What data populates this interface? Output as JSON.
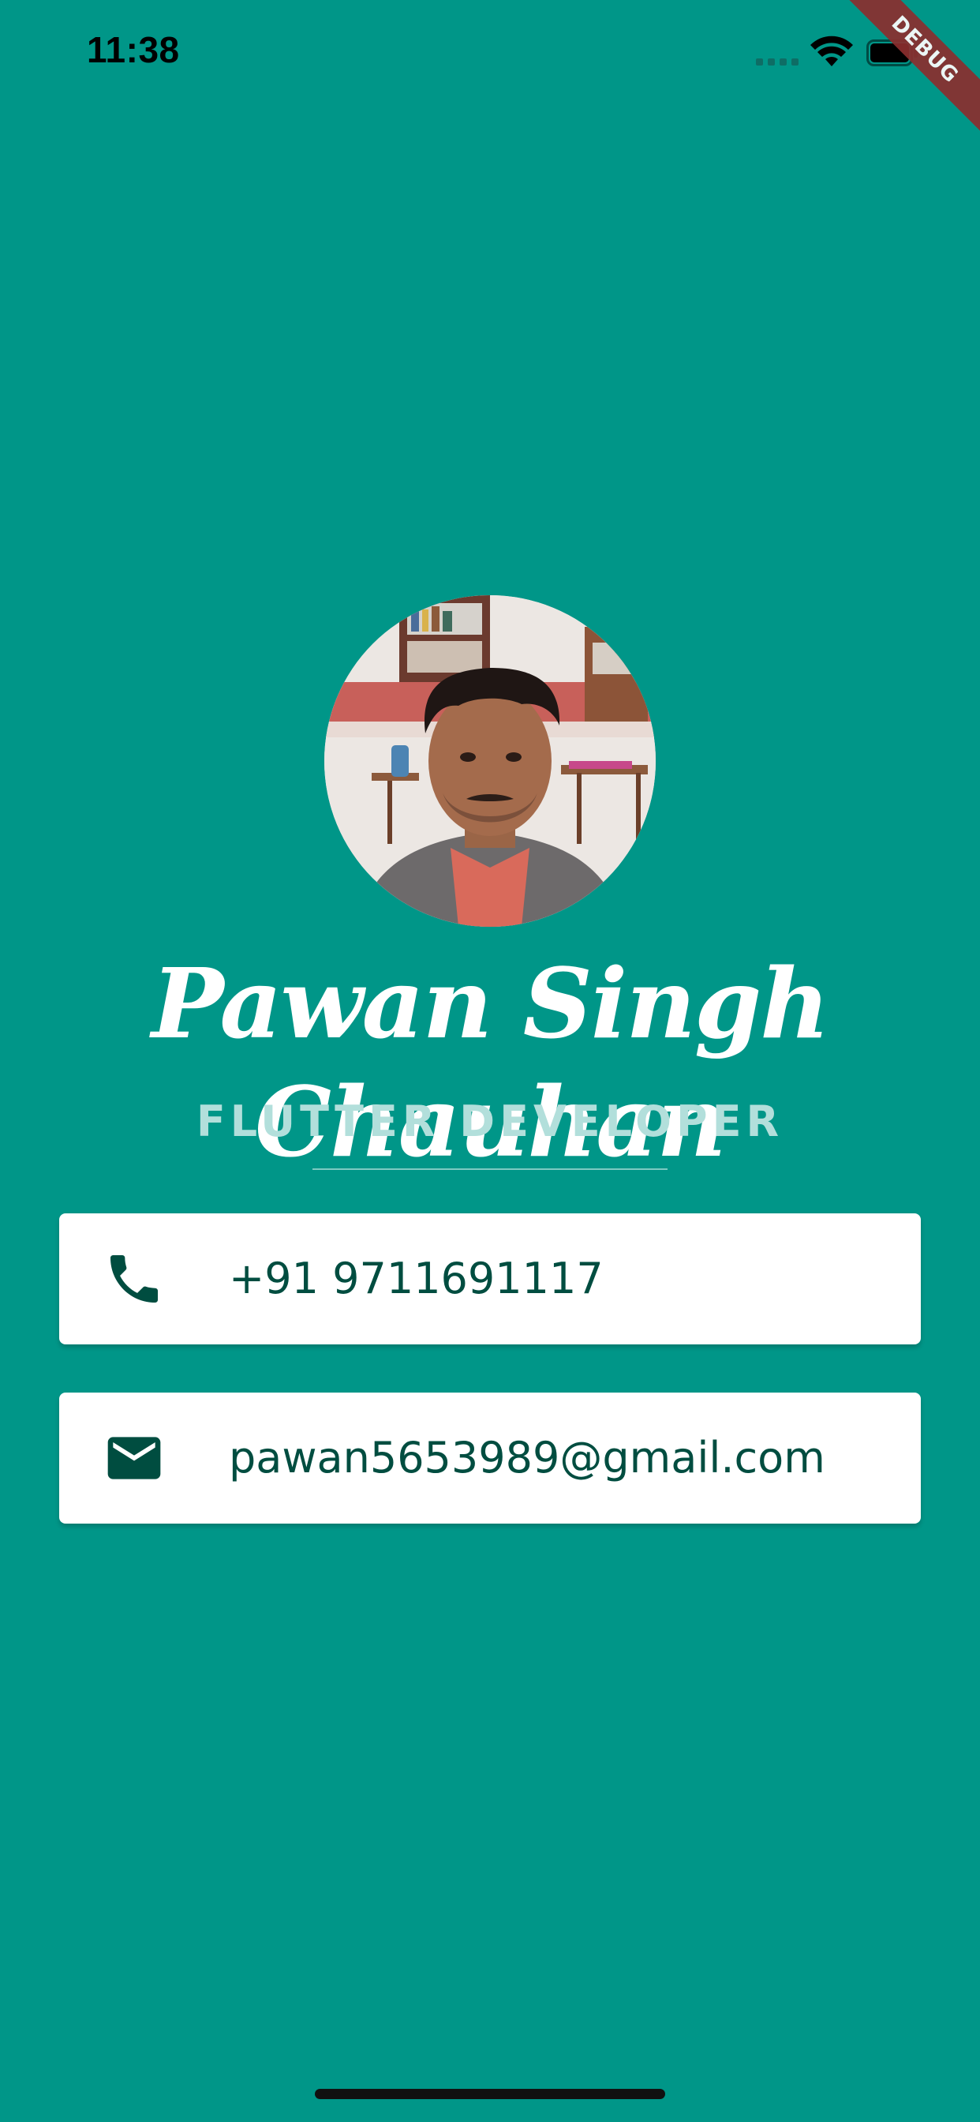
{
  "status_bar": {
    "time": "11:38",
    "icons": [
      "cellular-signal-icon",
      "wifi-icon",
      "battery-icon"
    ]
  },
  "debug_banner": "DEBUG",
  "profile": {
    "avatar_description": "profile-photo",
    "name": "Pawan Singh Chauhan",
    "title": "FLUTTER DEVELOPER"
  },
  "contacts": {
    "phone": {
      "icon": "phone-icon",
      "value": "+91 9711691117"
    },
    "email": {
      "icon": "mail-icon",
      "value": "pawan5653989@gmail.com"
    }
  },
  "colors": {
    "background": "#009688",
    "title_text": "#b2dfdb",
    "card_text": "#004d40",
    "card_background": "#ffffff",
    "debug_ribbon": "#8b2e2e"
  }
}
